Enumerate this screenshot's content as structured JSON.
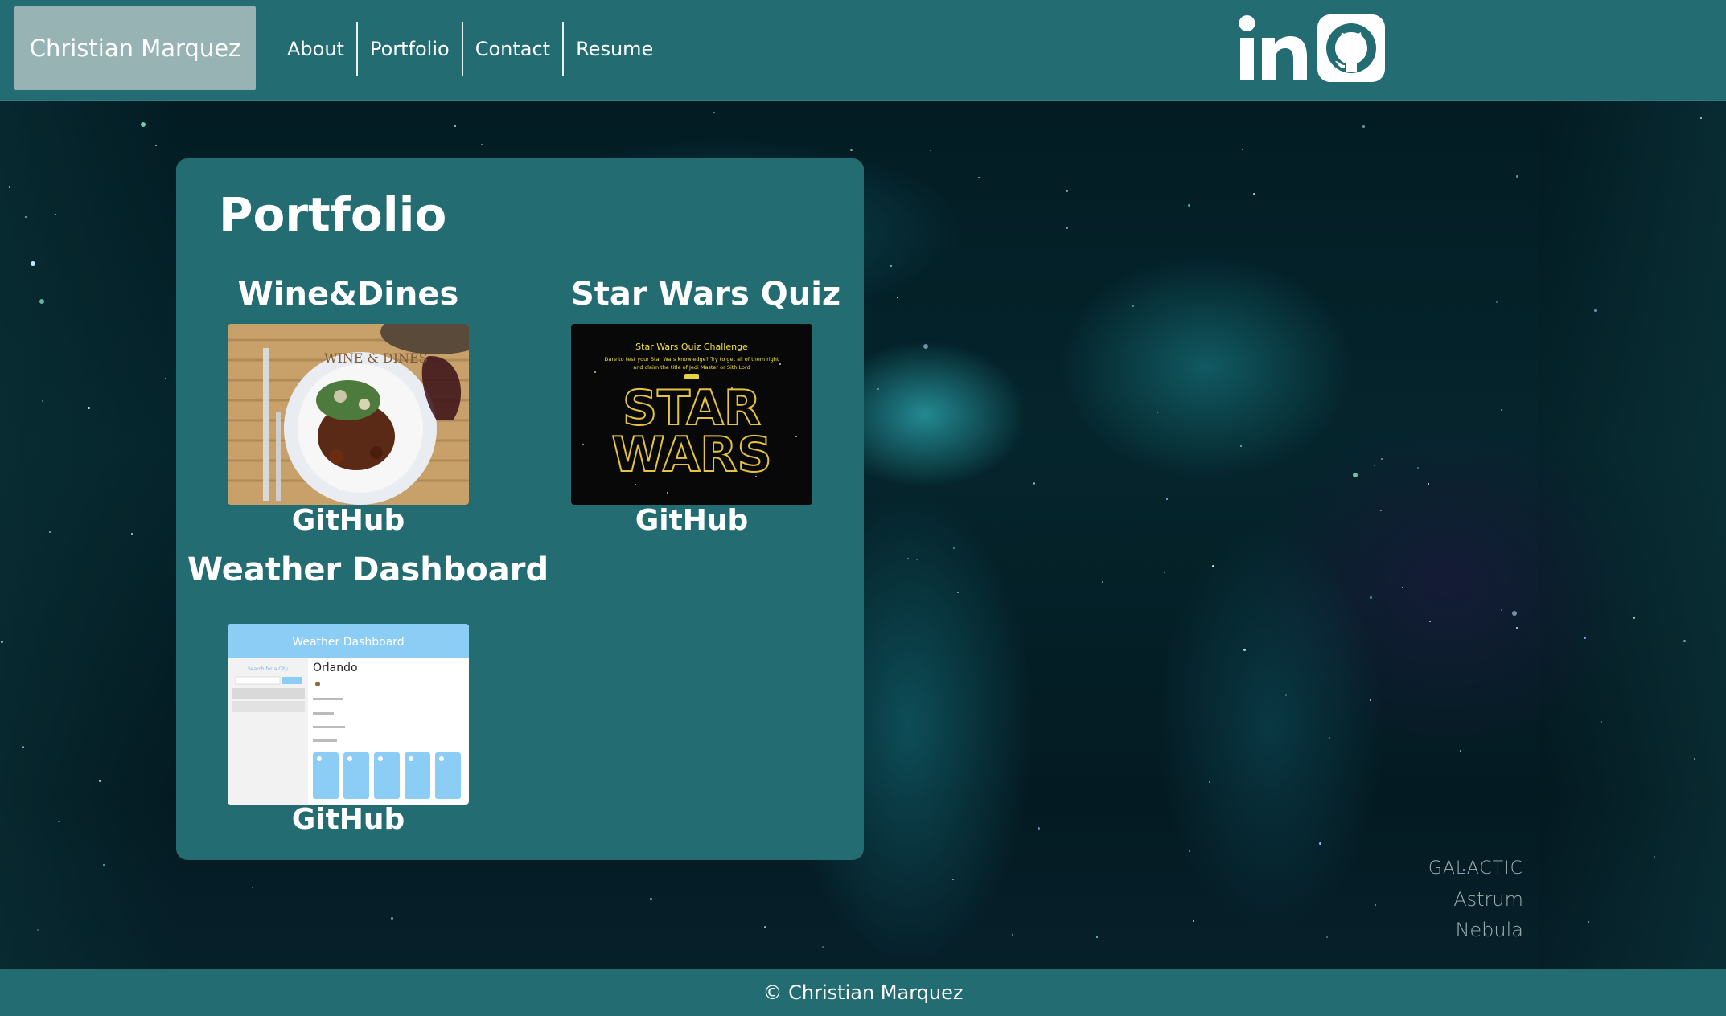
{
  "header": {
    "brand": "Christian Marquez",
    "nav": [
      "About",
      "Portfolio",
      "Contact",
      "Resume"
    ],
    "social_icons": [
      "linkedin-icon",
      "github-icon"
    ]
  },
  "portfolio": {
    "title": "Portfolio",
    "projects": [
      {
        "title": "Wine&Dines",
        "link_label": "GitHub",
        "thumbnail": {
          "logo": "WINE & DINES"
        }
      },
      {
        "title": "Star Wars Quiz",
        "link_label": "GitHub",
        "thumbnail": {
          "heading": "Star Wars Quiz Challenge",
          "sub1": "Dare to test your Star Wars knowledge? Try to get all of them right",
          "sub2": "and claim the title of Jedi Master or Sith Lord",
          "logo_top": "STAR",
          "logo_bottom": "WARS"
        }
      },
      {
        "title": "Weather Dashboard",
        "link_label": "GitHub",
        "thumbnail": {
          "header": "Weather Dashboard",
          "search_label": "Search for a City",
          "city": "Orlando"
        }
      }
    ]
  },
  "background": {
    "watermark_brand": "GALACTIC",
    "watermark_name": "Astrum Nebula"
  },
  "footer": {
    "text": "© Christian Marquez"
  },
  "colors": {
    "header": "#226c72",
    "brand_bg": "#97b3b4",
    "card": "#226c72"
  }
}
